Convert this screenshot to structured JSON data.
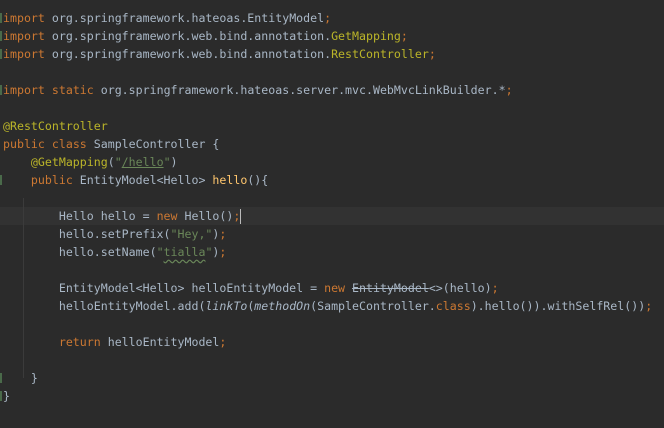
{
  "editor": {
    "colors": {
      "background": "#2b2b2b",
      "text": "#a9b7c6",
      "keyword": "#cc7832",
      "annotation": "#bbb529",
      "string": "#6a8759",
      "declaration": "#ffc66d"
    },
    "current_line": 11,
    "lines": [
      [
        {
          "t": "import",
          "c": "kw"
        },
        {
          "t": " org.springframework.hateoas.EntityModel"
        },
        {
          "t": ";",
          "c": "kw"
        }
      ],
      [
        {
          "t": "import",
          "c": "kw"
        },
        {
          "t": " org.springframework.web.bind.annotation."
        },
        {
          "t": "GetMapping",
          "c": "ann"
        },
        {
          "t": ";",
          "c": "kw"
        }
      ],
      [
        {
          "t": "import",
          "c": "kw"
        },
        {
          "t": " org.springframework.web.bind.annotation."
        },
        {
          "t": "RestController",
          "c": "ann"
        },
        {
          "t": ";",
          "c": "kw"
        }
      ],
      [],
      [
        {
          "t": "import",
          "c": "kw"
        },
        {
          "t": " "
        },
        {
          "t": "static",
          "c": "kw"
        },
        {
          "t": " org.springframework.hateoas.server.mvc.WebMvcLinkBuilder.*"
        },
        {
          "t": ";",
          "c": "kw"
        }
      ],
      [],
      [
        {
          "t": "@RestController",
          "c": "ann"
        }
      ],
      [
        {
          "t": "public",
          "c": "kw"
        },
        {
          "t": " "
        },
        {
          "t": "class",
          "c": "kw"
        },
        {
          "t": " SampleController {"
        }
      ],
      [
        {
          "t": "    "
        },
        {
          "t": "@GetMapping",
          "c": "ann"
        },
        {
          "t": "("
        },
        {
          "t": "\"",
          "c": "str"
        },
        {
          "t": "/hello",
          "c": "str-u"
        },
        {
          "t": "\"",
          "c": "str"
        },
        {
          "t": ")"
        }
      ],
      [
        {
          "t": "    "
        },
        {
          "t": "public",
          "c": "kw"
        },
        {
          "t": " EntityModel<Hello> "
        },
        {
          "t": "hello",
          "c": "decl"
        },
        {
          "t": "(){"
        }
      ],
      [],
      [
        {
          "t": "        Hello hello = "
        },
        {
          "t": "new",
          "c": "kw"
        },
        {
          "t": " Hello()"
        },
        {
          "t": ";",
          "c": "kw"
        }
      ],
      [
        {
          "t": "        hello.setPrefix("
        },
        {
          "t": "\"Hey,\"",
          "c": "str"
        },
        {
          "t": ")"
        },
        {
          "t": ";",
          "c": "kw"
        }
      ],
      [
        {
          "t": "        hello.setName("
        },
        {
          "t": "\"",
          "c": "str"
        },
        {
          "t": "tialla",
          "c": "str-w"
        },
        {
          "t": "\"",
          "c": "str"
        },
        {
          "t": ")"
        },
        {
          "t": ";",
          "c": "kw"
        }
      ],
      [],
      [
        {
          "t": "        EntityModel<Hello> helloEntityModel = "
        },
        {
          "t": "new",
          "c": "kw"
        },
        {
          "t": " "
        },
        {
          "t": "EntityModel",
          "c": "dep"
        },
        {
          "t": "<>(hello)"
        },
        {
          "t": ";",
          "c": "kw"
        }
      ],
      [
        {
          "t": "        helloEntityModel.add("
        },
        {
          "t": "linkTo",
          "c": "it"
        },
        {
          "t": "("
        },
        {
          "t": "methodOn",
          "c": "it"
        },
        {
          "t": "(SampleController."
        },
        {
          "t": "class",
          "c": "kw"
        },
        {
          "t": ").hello()).withSelfRel())"
        },
        {
          "t": ";",
          "c": "kw"
        },
        {
          "t": "  +"
        }
      ],
      [],
      [
        {
          "t": "        "
        },
        {
          "t": "return",
          "c": "kw"
        },
        {
          "t": " helloEntityModel"
        },
        {
          "t": ";",
          "c": "kw"
        }
      ],
      [],
      [
        {
          "t": "    }"
        }
      ],
      [
        {
          "t": "}"
        }
      ]
    ]
  }
}
